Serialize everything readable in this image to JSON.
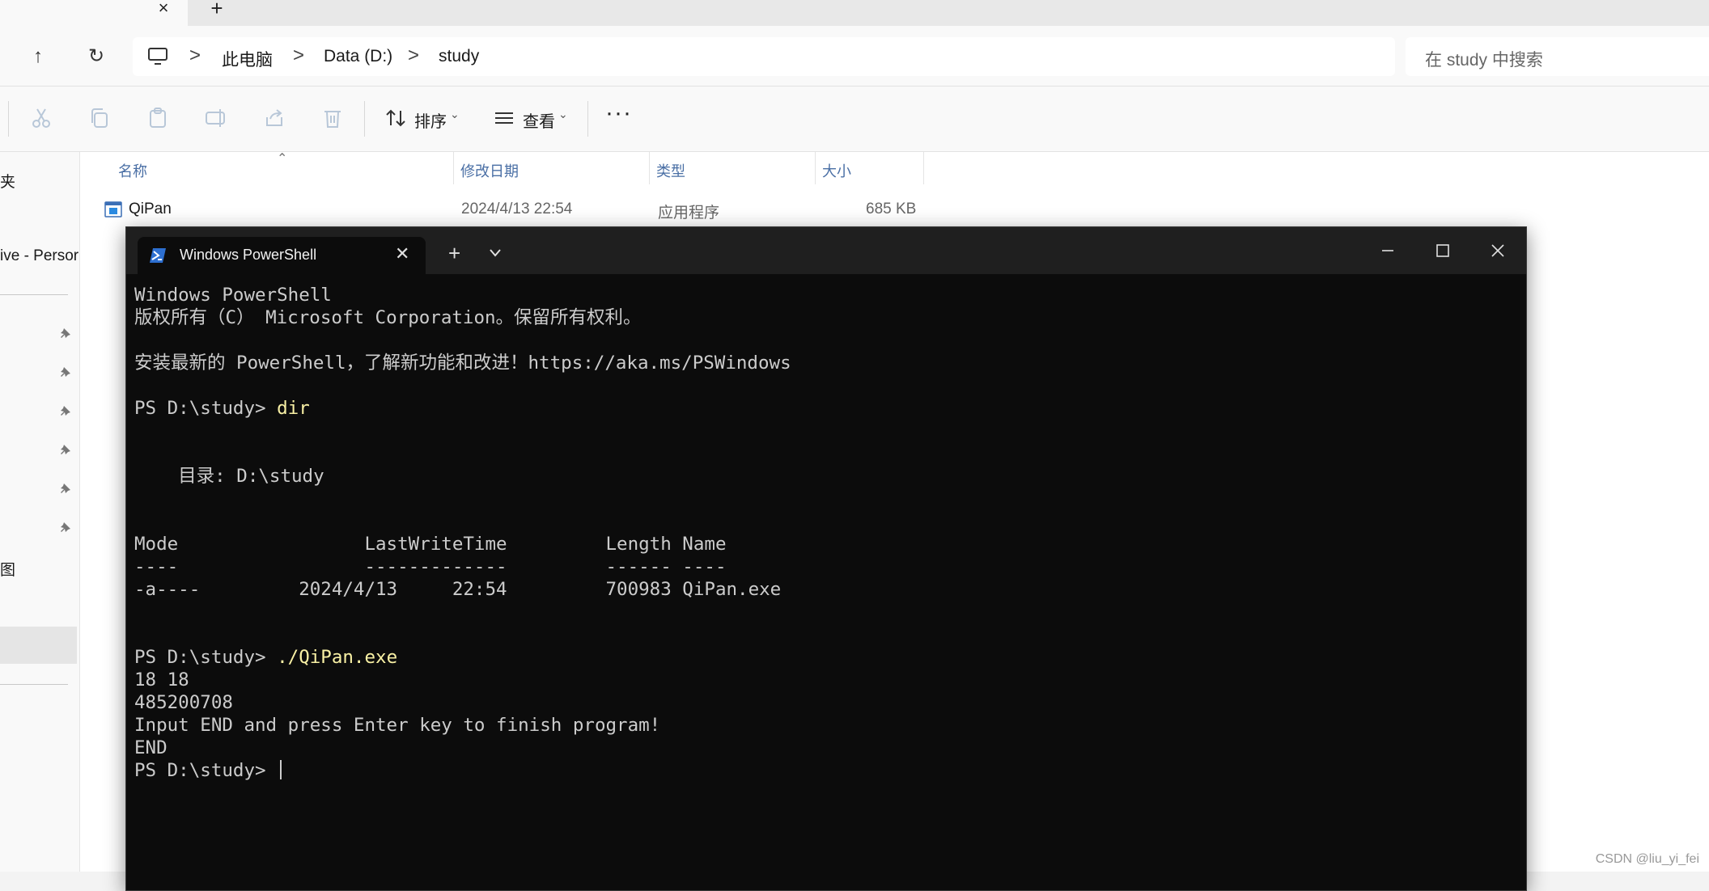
{
  "explorer": {
    "tab_close_glyph": "×",
    "tab_new_glyph": "+",
    "nav": {
      "up_glyph": "↑",
      "refresh_glyph": "↻"
    },
    "breadcrumb": [
      "此电脑",
      "Data (D:)",
      "study"
    ],
    "breadcrumb_sep": ">",
    "search_placeholder": "在 study 中搜索",
    "toolbar": {
      "sort_label": "排序",
      "view_label": "查看",
      "more_glyph": "···",
      "chevron_glyph": "⌄"
    },
    "sidebar": {
      "items": [
        "夹",
        "ive - Persor",
        "图"
      ]
    },
    "columns": {
      "name": "名称",
      "modified": "修改日期",
      "type": "类型",
      "size": "大小",
      "sort_glyph": "⌃"
    },
    "files": [
      {
        "name": "QiPan",
        "modified": "2024/4/13 22:54",
        "type": "应用程序",
        "size": "685 KB"
      }
    ]
  },
  "powershell": {
    "tab_title": "Windows PowerShell",
    "tab_close_glyph": "✕",
    "new_tab_glyph": "+",
    "console_lines": [
      {
        "text": "Windows PowerShell",
        "cmd": ""
      },
      {
        "text": "版权所有（C） Microsoft Corporation。保留所有权利。",
        "cmd": ""
      },
      {
        "text": "",
        "cmd": ""
      },
      {
        "text": "安装最新的 PowerShell，了解新功能和改进！https://aka.ms/PSWindows",
        "cmd": ""
      },
      {
        "text": "",
        "cmd": ""
      },
      {
        "text": "PS D:\\study> ",
        "cmd": "dir"
      },
      {
        "text": "",
        "cmd": ""
      },
      {
        "text": "",
        "cmd": ""
      },
      {
        "text": "    目录: D:\\study",
        "cmd": ""
      },
      {
        "text": "",
        "cmd": ""
      },
      {
        "text": "",
        "cmd": ""
      },
      {
        "text": "Mode                 LastWriteTime         Length Name",
        "cmd": ""
      },
      {
        "text": "----                 -------------         ------ ----",
        "cmd": ""
      },
      {
        "text": "-a----         2024/4/13     22:54         700983 QiPan.exe",
        "cmd": ""
      },
      {
        "text": "",
        "cmd": ""
      },
      {
        "text": "",
        "cmd": ""
      },
      {
        "text": "PS D:\\study> ",
        "cmd": "./QiPan.exe"
      },
      {
        "text": "18 18",
        "cmd": ""
      },
      {
        "text": "485200708",
        "cmd": ""
      },
      {
        "text": "Input END and press Enter key to finish program!",
        "cmd": ""
      },
      {
        "text": "END",
        "cmd": ""
      }
    ],
    "prompt_line": "PS D:\\study> ",
    "colors": {
      "background": "#0c0c0c",
      "text": "#cccccc",
      "command": "#f9f1a5"
    }
  },
  "watermark": "CSDN @liu_yi_fei"
}
